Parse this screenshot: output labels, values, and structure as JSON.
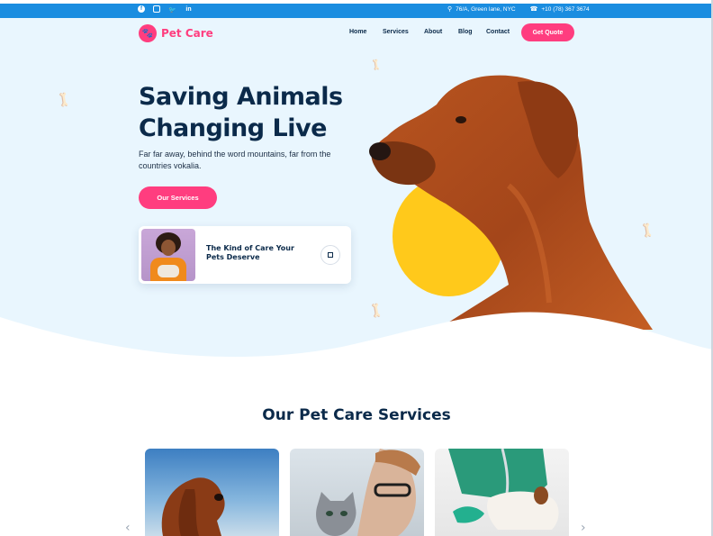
{
  "topbar": {
    "social_icons": [
      "facebook-icon",
      "instagram-icon",
      "twitter-icon",
      "linkedin-icon"
    ],
    "address": "76/A, Green lane, NYC",
    "phone": "+10 (78) 367 3674",
    "color": "#1a8de0"
  },
  "header": {
    "logo_text": "Pet Care",
    "nav": [
      "Home",
      "Services",
      "About",
      "Blog",
      "Contact"
    ],
    "cta_label": "Get Quote"
  },
  "hero": {
    "title_line1": "Saving Animals",
    "title_line2": "Changing Live",
    "subtitle": "Far far away, behind the word mountains, far from the countries vokalia.",
    "button_label": "Our Services",
    "card_title": "The Kind of Care Your Pets Deserve"
  },
  "services": {
    "title": "Our Pet Care Services"
  },
  "colors": {
    "accent": "#ff3d7f",
    "navy": "#0b2a4a",
    "hero_bg": "#e9f6fe",
    "yellow": "#ffc91b"
  }
}
